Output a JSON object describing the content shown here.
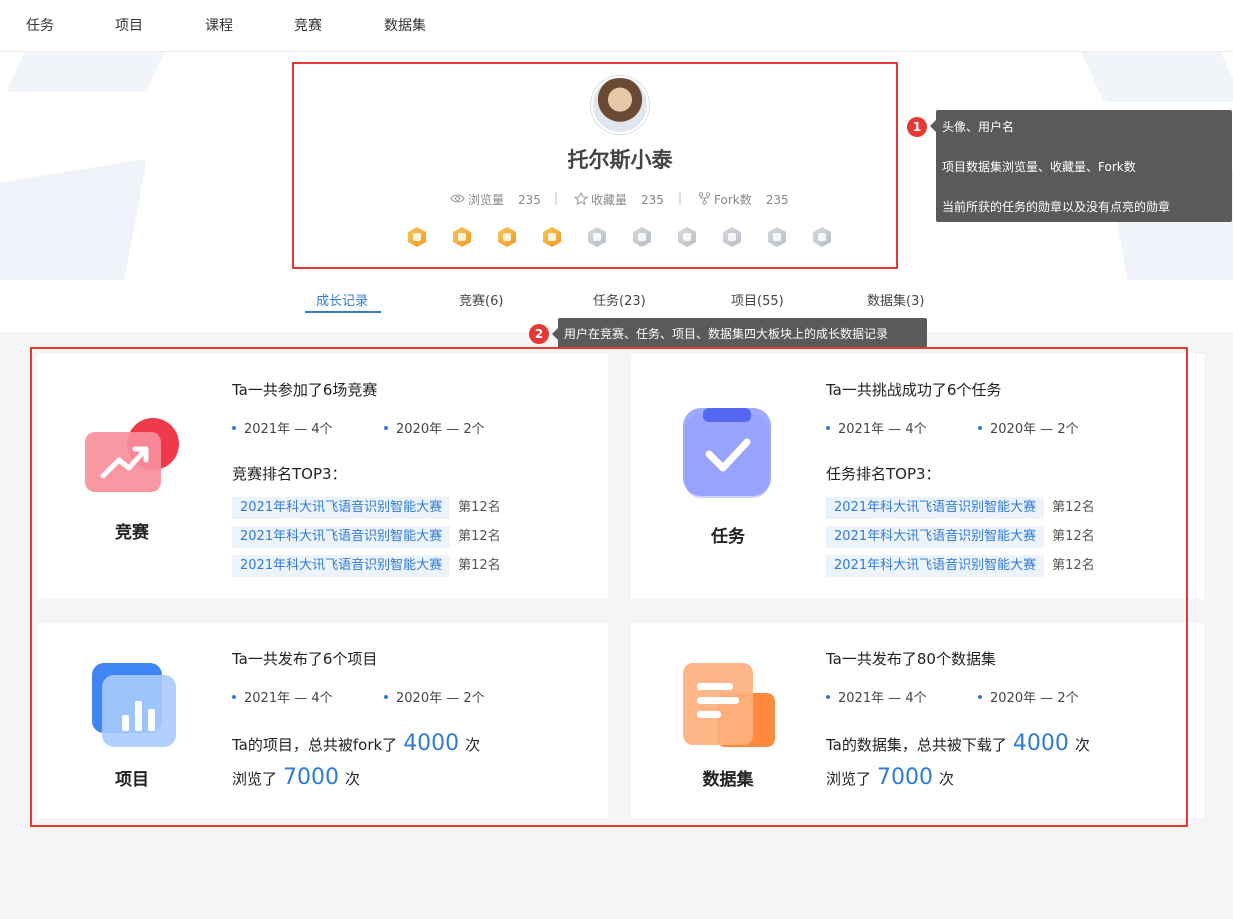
{
  "nav": [
    "任务",
    "项目",
    "课程",
    "竞赛",
    "数据集"
  ],
  "profile": {
    "username": "托尔斯小泰",
    "stats": [
      {
        "icon": "eye-icon",
        "label": "浏览量",
        "value": "235"
      },
      {
        "icon": "star-icon",
        "label": "收藏量",
        "value": "235"
      },
      {
        "icon": "fork-icon",
        "label": "Fork数",
        "value": "235"
      }
    ],
    "separator": "|",
    "badges": [
      {
        "earned": true
      },
      {
        "earned": true
      },
      {
        "earned": true
      },
      {
        "earned": true
      },
      {
        "earned": false
      },
      {
        "earned": false
      },
      {
        "earned": false
      },
      {
        "earned": false
      },
      {
        "earned": false
      },
      {
        "earned": false
      }
    ]
  },
  "tabs": [
    "成长记录",
    "竞赛(6)",
    "任务(23)",
    "项目(55)",
    "数据集(3)"
  ],
  "annotations": {
    "one": {
      "num": "1",
      "lines": [
        "头像、用户名",
        "项目数据集浏览量、收藏量、Fork数",
        "当前所获的任务的勋章以及没有点亮的勋章"
      ]
    },
    "two": {
      "num": "2",
      "text": "用户在竞赛、任务、项目、数据集四大板块上的成长数据记录"
    }
  },
  "cards": {
    "competition": {
      "label": "竞赛",
      "title": "Ta一共参加了6场竞赛",
      "years": [
        "2021年  —  4个",
        "2020年  —  2个"
      ],
      "rank_title": "竞赛排名TOP3：",
      "ranks": [
        {
          "name": "2021年科大讯飞语音识别智能大赛",
          "pos": "第12名"
        },
        {
          "name": "2021年科大讯飞语音识别智能大赛",
          "pos": "第12名"
        },
        {
          "name": "2021年科大讯飞语音识别智能大赛",
          "pos": "第12名"
        }
      ]
    },
    "task": {
      "label": "任务",
      "title": "Ta一共挑战成功了6个任务",
      "years": [
        "2021年  —  4个",
        "2020年  —  2个"
      ],
      "rank_title": "任务排名TOP3：",
      "ranks": [
        {
          "name": "2021年科大讯飞语音识别智能大赛",
          "pos": "第12名"
        },
        {
          "name": "2021年科大讯飞语音识别智能大赛",
          "pos": "第12名"
        },
        {
          "name": "2021年科大讯飞语音识别智能大赛",
          "pos": "第12名"
        }
      ]
    },
    "project": {
      "label": "项目",
      "title": "Ta一共发布了6个项目",
      "years": [
        "2021年  —  4个",
        "2020年  —  2个"
      ],
      "line1_pre": "Ta的项目，总共被fork了",
      "line1_num": "4000",
      "line1_post": "次",
      "line2_pre": "浏览了",
      "line2_num": "7000",
      "line2_post": "次"
    },
    "dataset": {
      "label": "数据集",
      "title": "Ta一共发布了80个数据集",
      "years": [
        "2021年  —  4个",
        "2020年  —  2个"
      ],
      "line1_pre": "Ta的数据集，总共被下载了",
      "line1_num": "4000",
      "line1_post": "次",
      "line2_pre": "浏览了",
      "line2_num": "7000",
      "line2_post": "次"
    }
  },
  "colors": {
    "accent": "#2f7bd9",
    "annotation": "#e53935",
    "callout_bg": "#5a5a5a"
  }
}
